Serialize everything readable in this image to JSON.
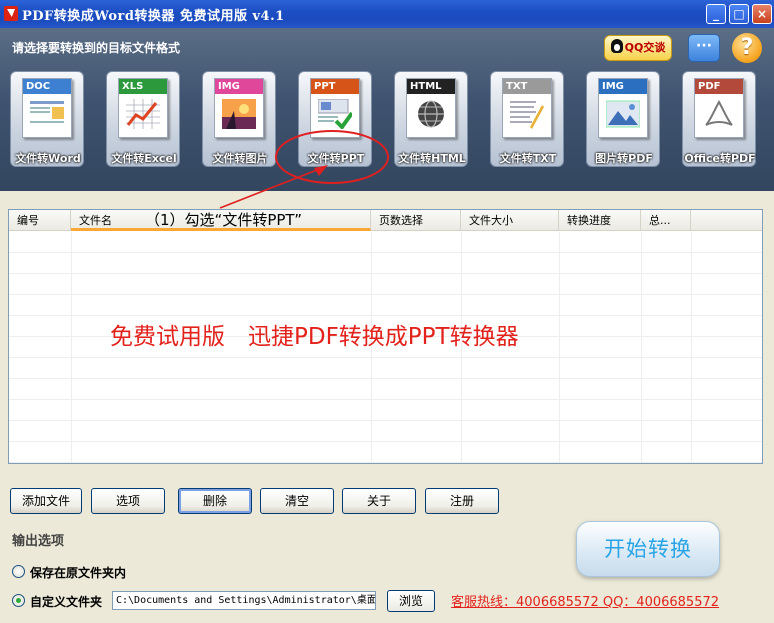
{
  "window": {
    "title": "PDF转换成Word转换器 免费试用版 v4.1",
    "min_label": "_",
    "max_label": "□",
    "close_label": "×"
  },
  "header": {
    "prompt": "请选择要转换到的目标文件格式",
    "qq_label": "QQ交谈",
    "chat_label": "···",
    "help_label": "?"
  },
  "formats": [
    {
      "tag": "DOC",
      "caption": "文件转Word",
      "color": "#3d7fd0"
    },
    {
      "tag": "XLS",
      "caption": "文件转Excel",
      "color": "#2c9a3c"
    },
    {
      "tag": "IMG",
      "caption": "文件转图片",
      "color": "#e0479a"
    },
    {
      "tag": "PPT",
      "caption": "文件转PPT",
      "color": "#d65418"
    },
    {
      "tag": "HTML",
      "caption": "文件转HTML",
      "color": "#222222"
    },
    {
      "tag": "TXT",
      "caption": "文件转TXT",
      "color": "#9a9a9a"
    },
    {
      "tag": "IMG",
      "caption": "图片转PDF",
      "color": "#2a6fc0"
    },
    {
      "tag": "PDF",
      "caption": "Office转PDF",
      "color": "#b2493a"
    }
  ],
  "annotation": {
    "text": "（1）勾选“文件转PPT”"
  },
  "list": {
    "columns": [
      "编号",
      "文件名",
      "页数选择",
      "文件大小",
      "转换进度",
      "总..."
    ],
    "watermark": "免费试用版　迅捷PDF转换成PPT转换器"
  },
  "buttons": {
    "add_files": "添加文件",
    "options": "选项",
    "delete": "删除",
    "clear": "清空",
    "about": "关于",
    "register": "注册"
  },
  "output": {
    "label": "输出选项",
    "option_original": "保存在原文件夹内",
    "option_custom": "自定义文件夹",
    "path": "C:\\Documents and Settings\\Administrator\\桌面",
    "browse": "浏览",
    "selected": "custom"
  },
  "start_label": "开始转换",
  "hotline": "客服热线：4006685572 QQ：4006685572"
}
